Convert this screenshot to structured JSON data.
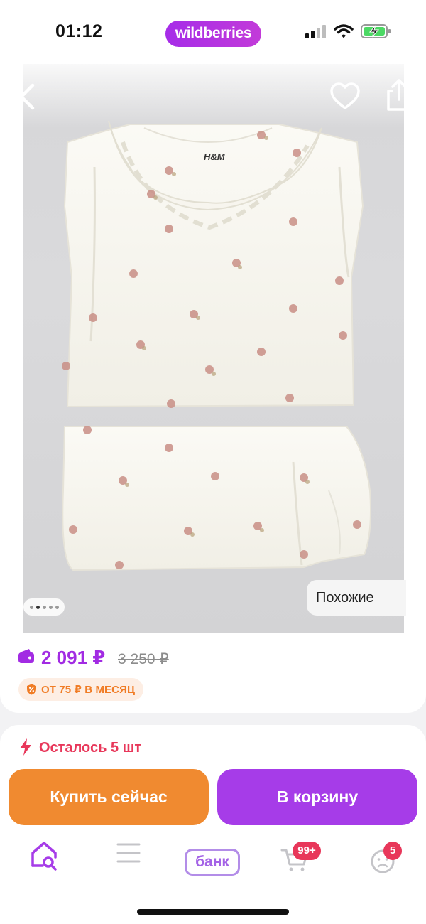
{
  "status_bar": {
    "time": "01:12",
    "brand": "wildberries",
    "icons": [
      "signal-icon",
      "wifi-icon",
      "battery-charging-icon"
    ]
  },
  "product_photo": {
    "brand_label": "H&M",
    "slide_count": 5,
    "active_slide": 2,
    "similar_label": "Похожие",
    "icons": [
      "back-arrow-icon",
      "heart-icon",
      "share-icon"
    ]
  },
  "price": {
    "current": "2 091 ₽",
    "old": "3 250 ₽",
    "installment": "ОТ 75 ₽ В МЕСЯЦ",
    "colors": {
      "current": "#a22be3",
      "installment": "#f07c25"
    }
  },
  "purchase": {
    "stock_text": "Осталось 5 шт",
    "buy_now_label": "Купить сейчас",
    "add_to_cart_label": "В корзину",
    "colors": {
      "buy_now": "#f08a30",
      "add_to_cart": "#a63ce8",
      "stock": "#e8375a"
    }
  },
  "tab_bar": {
    "bank_label": "банк",
    "cart_badge": "99+",
    "profile_badge": "5",
    "icons": [
      "home-search-icon",
      "catalog-menu-icon",
      "bank-icon",
      "cart-icon",
      "profile-icon"
    ]
  }
}
